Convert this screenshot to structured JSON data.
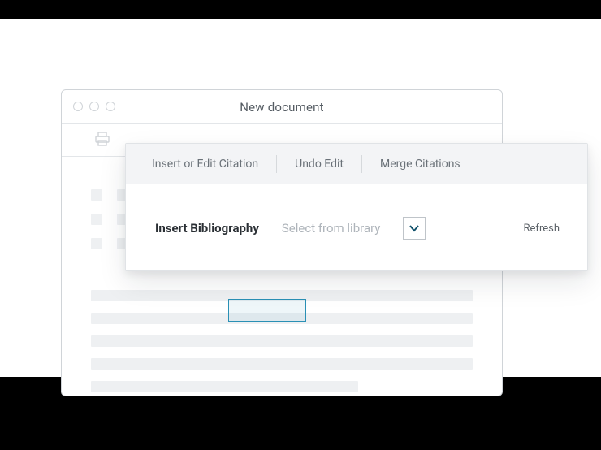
{
  "window": {
    "title": "New document"
  },
  "popover": {
    "tabs": {
      "insert_edit": "Insert or Edit Citation",
      "undo": "Undo Edit",
      "merge": "Merge Citations"
    },
    "row": {
      "insert_bibliography": "Insert Bibliography",
      "select_label": "Select from library",
      "refresh": "Refresh"
    }
  }
}
